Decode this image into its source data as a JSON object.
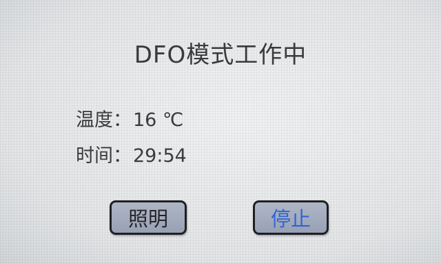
{
  "screen": {
    "title": "DFO模式工作中"
  },
  "status": {
    "temperature_label": "温度：",
    "temperature_value": "16 ℃",
    "time_label": "时间：",
    "time_value": "29:54"
  },
  "buttons": {
    "light_label": "照明",
    "stop_label": "停止"
  },
  "colors": {
    "stop_text": "#2f63d6",
    "button_fill": "#a3abbd",
    "text": "#3a3a3d"
  }
}
